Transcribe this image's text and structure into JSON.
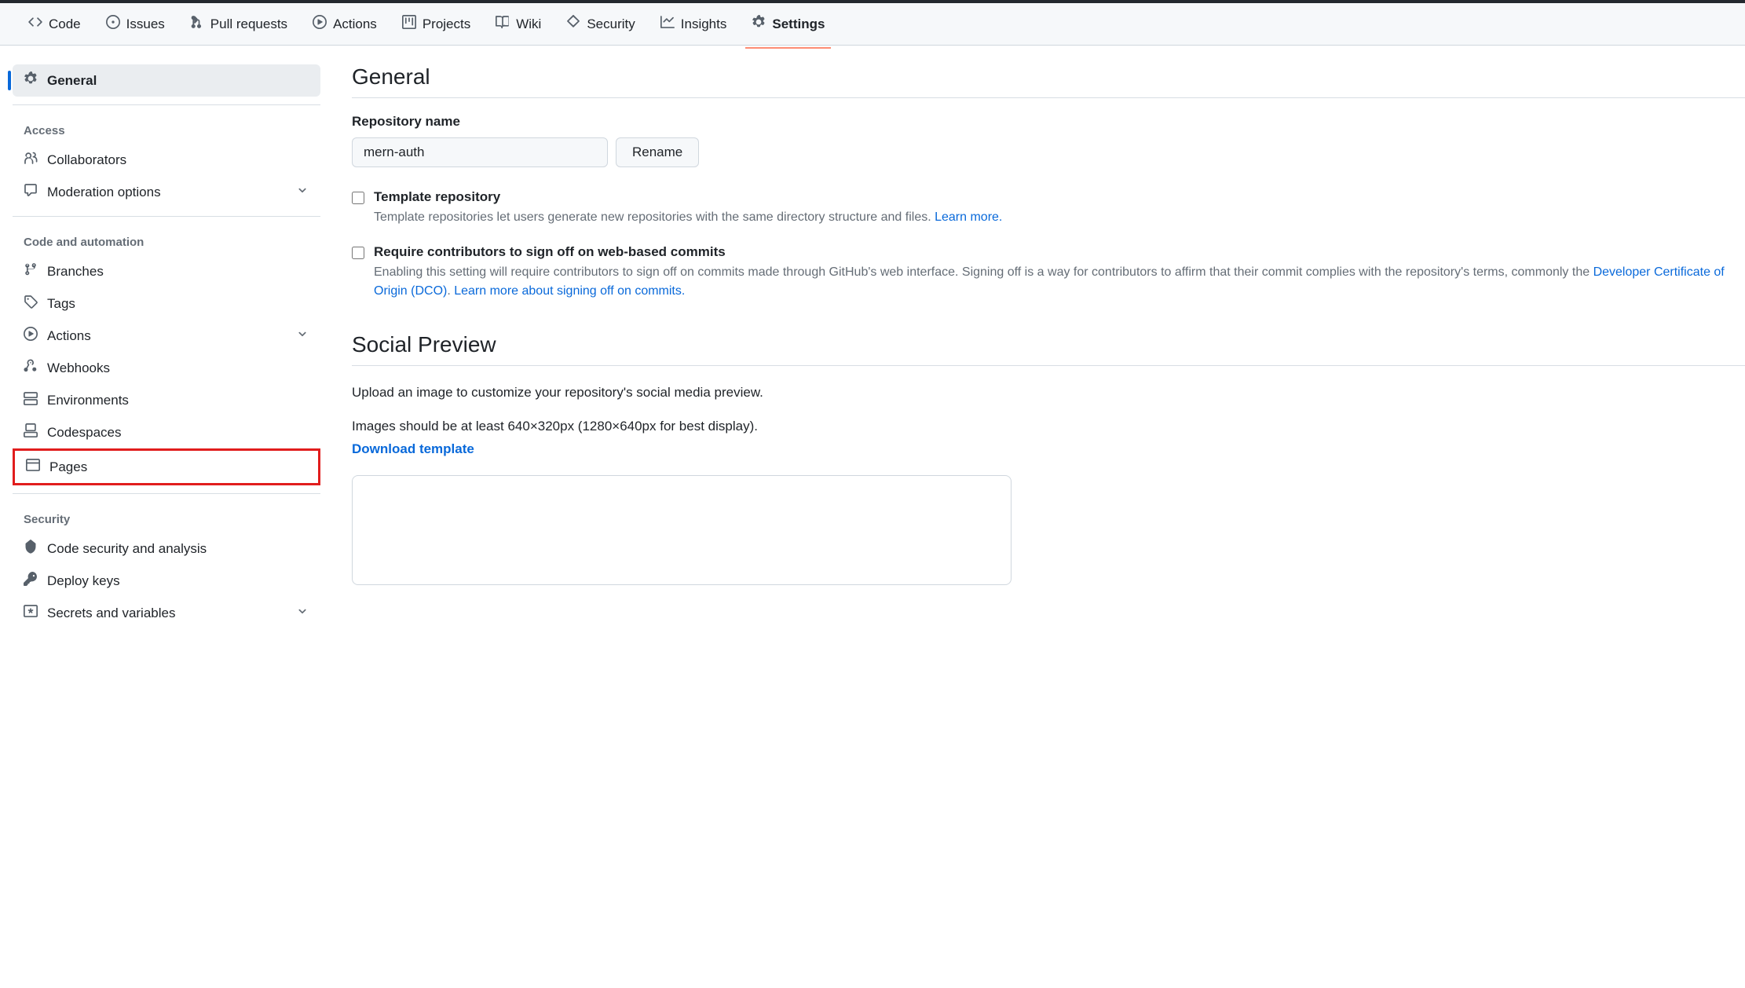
{
  "topnav": {
    "items": [
      {
        "label": "Code"
      },
      {
        "label": "Issues"
      },
      {
        "label": "Pull requests"
      },
      {
        "label": "Actions"
      },
      {
        "label": "Projects"
      },
      {
        "label": "Wiki"
      },
      {
        "label": "Security"
      },
      {
        "label": "Insights"
      },
      {
        "label": "Settings"
      }
    ]
  },
  "sidebar": {
    "general": "General",
    "access_heading": "Access",
    "access": [
      {
        "label": "Collaborators"
      },
      {
        "label": "Moderation options"
      }
    ],
    "code_heading": "Code and automation",
    "code": [
      {
        "label": "Branches"
      },
      {
        "label": "Tags"
      },
      {
        "label": "Actions"
      },
      {
        "label": "Webhooks"
      },
      {
        "label": "Environments"
      },
      {
        "label": "Codespaces"
      },
      {
        "label": "Pages"
      }
    ],
    "security_heading": "Security",
    "security": [
      {
        "label": "Code security and analysis"
      },
      {
        "label": "Deploy keys"
      },
      {
        "label": "Secrets and variables"
      }
    ]
  },
  "main": {
    "general_title": "General",
    "repo_name_label": "Repository name",
    "repo_name_value": "mern-auth",
    "rename_label": "Rename",
    "template_title": "Template repository",
    "template_desc": "Template repositories let users generate new repositories with the same directory structure and files. ",
    "template_link": "Learn more.",
    "signoff_title": "Require contributors to sign off on web-based commits",
    "signoff_desc1": "Enabling this setting will require contributors to sign off on commits made through GitHub's web interface. Signing off is a way for contributors to affirm that their commit complies with the repository's terms, commonly the ",
    "signoff_link1": "Developer Certificate of Origin (DCO)",
    "signoff_sep": ". ",
    "signoff_link2": "Learn more about signing off on commits.",
    "social_title": "Social Preview",
    "social_line1": "Upload an image to customize your repository's social media preview.",
    "social_line2": "Images should be at least 640×320px (1280×640px for best display).",
    "social_link": "Download template"
  }
}
